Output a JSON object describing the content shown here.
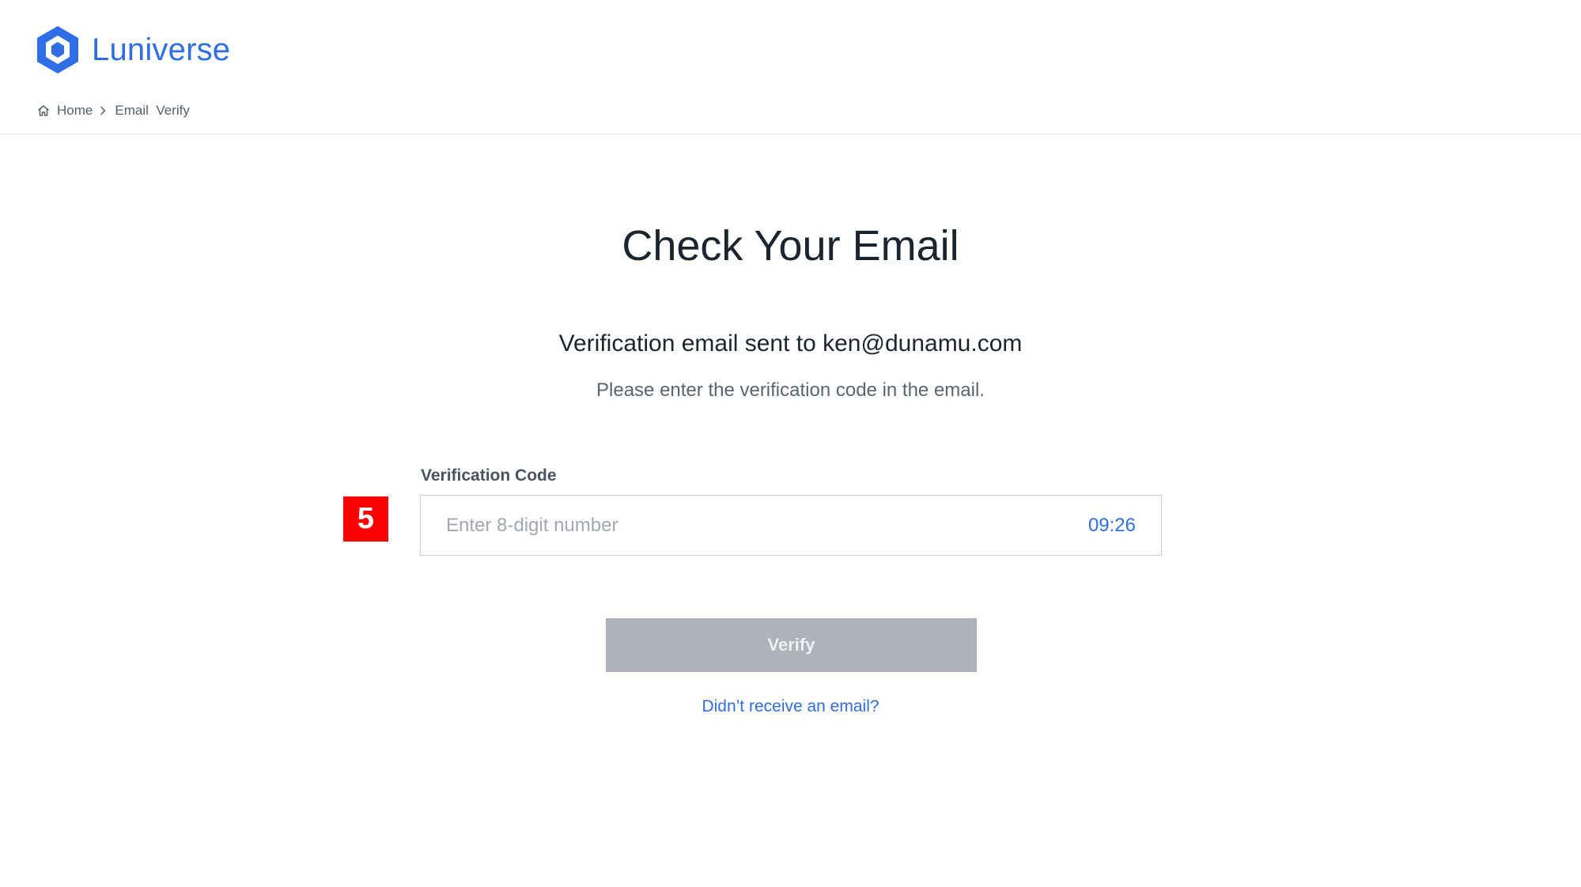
{
  "header": {
    "logo_text": "Luniverse",
    "brand_color": "#2f6ee6"
  },
  "breadcrumb": {
    "home_icon": "home-icon",
    "home_label": "Home",
    "separator_icon": "chevron-right-icon",
    "current_label": "Email  Verify"
  },
  "main": {
    "title": "Check Your Email",
    "sent_line": "Verification email sent to ken@dunamu.com",
    "instruction": "Please enter the verification code in the email.",
    "field_label": "Verification Code",
    "code_input": {
      "value": "",
      "placeholder": "Enter 8-digit number"
    },
    "timer": "09:26",
    "step_badge": "5",
    "verify_label": "Verify",
    "resend_label": "Didn’t receive an email?"
  },
  "colors": {
    "button_disabled": "#adb2bb",
    "badge": "#ff0000",
    "link": "#2f6ee6"
  }
}
